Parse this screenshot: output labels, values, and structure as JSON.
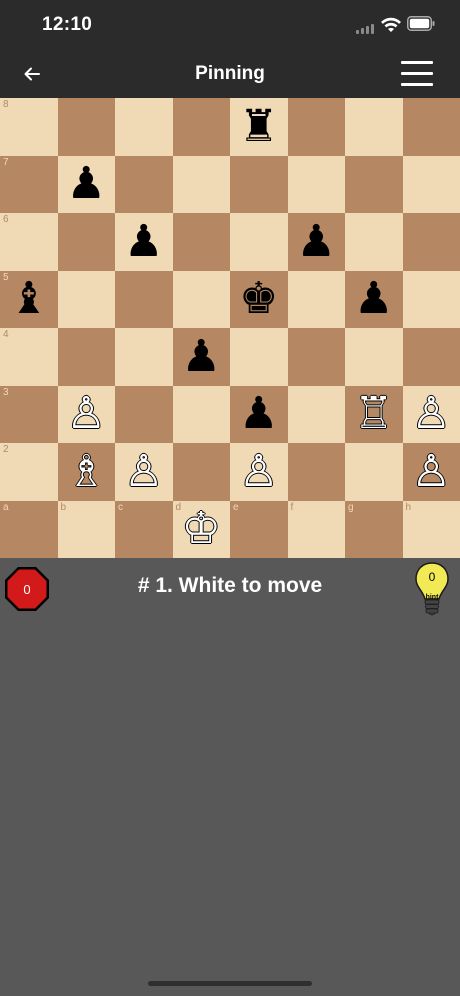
{
  "status_bar": {
    "time": "12:10"
  },
  "nav": {
    "title": "Pinning"
  },
  "board": {
    "colors": {
      "light": "#f0d9b5",
      "dark": "#b58863"
    },
    "rank_labels": [
      "8",
      "7",
      "6",
      "5",
      "4",
      "3",
      "2"
    ],
    "file_labels": [
      "a",
      "b",
      "c",
      "d",
      "e",
      "f",
      "g",
      "h"
    ],
    "pieces": [
      {
        "square": "e8",
        "type": "rook",
        "color": "black",
        "glyph": "♜"
      },
      {
        "square": "b7",
        "type": "pawn",
        "color": "black",
        "glyph": "♟"
      },
      {
        "square": "c6",
        "type": "pawn",
        "color": "black",
        "glyph": "♟"
      },
      {
        "square": "f6",
        "type": "pawn",
        "color": "black",
        "glyph": "♟"
      },
      {
        "square": "a5",
        "type": "bishop",
        "color": "black",
        "glyph": "♝"
      },
      {
        "square": "e5",
        "type": "king",
        "color": "black",
        "glyph": "♚"
      },
      {
        "square": "g5",
        "type": "pawn",
        "color": "black",
        "glyph": "♟"
      },
      {
        "square": "d4",
        "type": "pawn",
        "color": "black",
        "glyph": "♟"
      },
      {
        "square": "b3",
        "type": "pawn",
        "color": "white",
        "glyph": "♙"
      },
      {
        "square": "e3",
        "type": "pawn",
        "color": "black",
        "glyph": "♟"
      },
      {
        "square": "g3",
        "type": "rook",
        "color": "white",
        "glyph": "♖"
      },
      {
        "square": "h3",
        "type": "pawn",
        "color": "white",
        "glyph": "♙"
      },
      {
        "square": "b2",
        "type": "bishop",
        "color": "white",
        "glyph": "♗"
      },
      {
        "square": "c2",
        "type": "pawn",
        "color": "white",
        "glyph": "♙"
      },
      {
        "square": "e2",
        "type": "pawn",
        "color": "white",
        "glyph": "♙"
      },
      {
        "square": "h2",
        "type": "pawn",
        "color": "white",
        "glyph": "♙"
      },
      {
        "square": "d1",
        "type": "king",
        "color": "white",
        "glyph": "♔"
      }
    ]
  },
  "info": {
    "mistakes_count": "0",
    "task": "# 1. White to move",
    "hint_count": "0",
    "hint_label": "hint"
  },
  "icons": {
    "back": "arrow-left-icon",
    "menu": "hamburger-menu-icon",
    "stop": "stop-sign-icon",
    "hint": "lightbulb-icon"
  }
}
